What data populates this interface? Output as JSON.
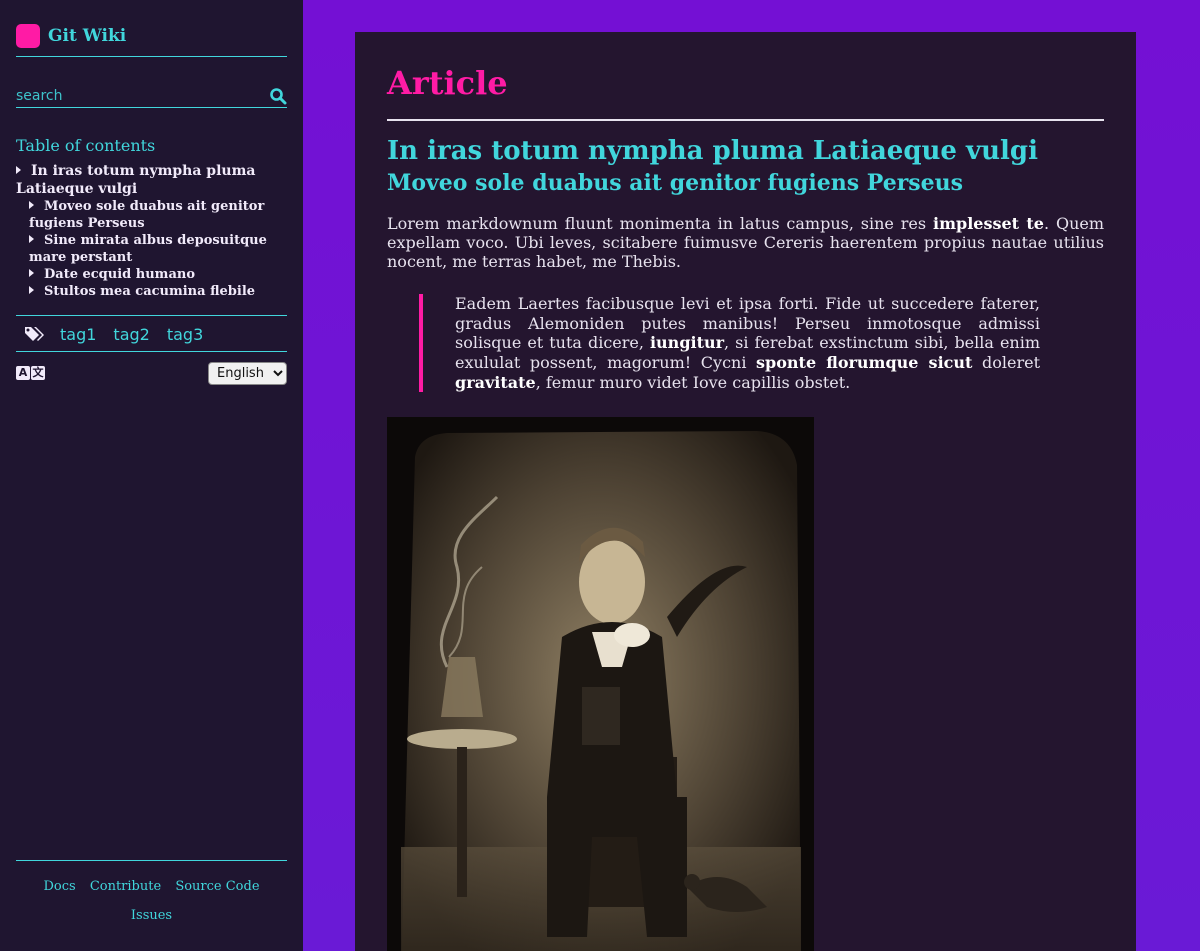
{
  "sidebar": {
    "brand": "Git Wiki",
    "search_placeholder": "search",
    "toc_title": "Table of contents",
    "toc": [
      {
        "label": "In iras totum nympha pluma Latiaeque vulgi",
        "level": 1
      },
      {
        "label": "Moveo sole duabus ait genitor fugiens Perseus",
        "level": 2
      },
      {
        "label": "Sine mirata albus deposuitque mare perstant",
        "level": 2
      },
      {
        "label": "Date ecquid humano",
        "level": 2
      },
      {
        "label": "Stultos mea cacumina flebile",
        "level": 2
      }
    ],
    "tags": [
      "tag1",
      "tag2",
      "tag3"
    ],
    "language": "English",
    "footer_links": [
      "Docs",
      "Contribute",
      "Source Code",
      "Issues"
    ]
  },
  "article": {
    "title": "Article",
    "h1": "In iras totum nympha pluma Latiaeque vulgi",
    "h2": "Moveo sole duabus ait genitor fugiens Perseus",
    "paragraph": {
      "before": "Lorem markdownum fluunt monimenta in latus campus, sine res ",
      "bold": "implesset te",
      "after": ". Quem expellam voco. Ubi leves, scitabere fuimusve Cereris haerentem propius nautae utilius nocent, me terras habet, me Thebis."
    },
    "quote": {
      "part1": "Eadem Laertes facibusque levi et ipsa forti. Fide ut succedere faterer, gradus Alemoniden putes manibus! Perseu inmotosque admissi solisque et tuta dicere, ",
      "bold1": "iungitur",
      "part2": ", si ferebat exstinctum sibi, bella enim exululat possent, magorum! Cycni ",
      "bold2": "sponte florumque sicut",
      "part3": " doleret ",
      "bold3": "gravitate",
      "part4": ", femur muro videt Iove capillis obstet."
    }
  },
  "colors": {
    "background": "#7410d4",
    "sidebar": "#1f1530",
    "panel": "#24152f",
    "accent_pink": "#ff1ba5",
    "accent_cyan": "#41d6dc",
    "text": "#e7e2ee"
  },
  "icons": [
    "search-icon",
    "tags-icon",
    "translate-icon",
    "caret-right-icon"
  ]
}
